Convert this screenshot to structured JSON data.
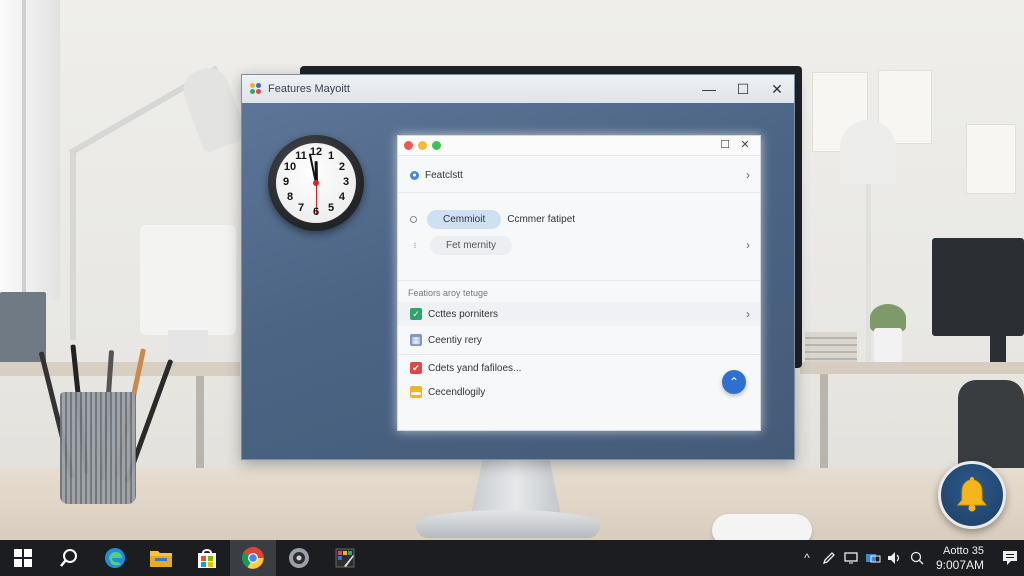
{
  "window": {
    "title": "Features Mayoitt",
    "minimize_glyph": "—",
    "maximize_glyph": "☐",
    "close_glyph": "✕"
  },
  "clock": {
    "numerals": [
      "12",
      "1",
      "2",
      "3",
      "4",
      "5",
      "6",
      "7",
      "8",
      "9",
      "10",
      "11"
    ],
    "hour": 11,
    "minute": 58,
    "second": 30
  },
  "panel": {
    "maximize_glyph": "☐",
    "close_glyph": "✕",
    "header_text": "Featclstt",
    "header_chevron": "›",
    "pill_primary": "Cemmioit",
    "pill_secondary": "Ccmmer fatipet",
    "pill_tertiary": "Fet mernity",
    "section_label": "Featiors aroy tetuge",
    "items": [
      {
        "icon": "check-square-icon",
        "icon_glyph": "✓",
        "icon_color": "#2ea36b",
        "text": "Ccttes porniters",
        "chevron": "›"
      },
      {
        "icon": "grid-icon",
        "icon_glyph": "▦",
        "icon_color": "#7d96c8",
        "text": "Ceentiy rery",
        "chevron": ""
      },
      {
        "icon": "checkmark-icon",
        "icon_glyph": "✔",
        "icon_color": "#e04848",
        "text": "Cdets yand fafiloes...",
        "chevron": ""
      },
      {
        "icon": "folder-icon",
        "icon_glyph": "▬",
        "icon_color": "#f0b428",
        "text": "Cecendlogily",
        "chevron": ""
      }
    ],
    "fab_glyph": "⌃"
  },
  "taskbar": {
    "apps": [
      {
        "name": "start-button",
        "label": "Start"
      },
      {
        "name": "search-button",
        "label": "Search"
      },
      {
        "name": "edge-browser",
        "label": "Edge"
      },
      {
        "name": "file-explorer",
        "label": "Files"
      },
      {
        "name": "store-app",
        "label": "Store"
      },
      {
        "name": "chrome-browser",
        "label": "Chrome"
      },
      {
        "name": "media-app",
        "label": "Media"
      },
      {
        "name": "paint-app",
        "label": "Paint"
      }
    ],
    "tray": {
      "chevron": "^",
      "time_line1": "Aotto 35",
      "time_line2": "9:007AM"
    }
  },
  "colors": {
    "accent": "#2f6fd0",
    "window_bg": "#4c6585",
    "taskbar_bg": "#1b1d20",
    "bell": "#f5b51d"
  }
}
